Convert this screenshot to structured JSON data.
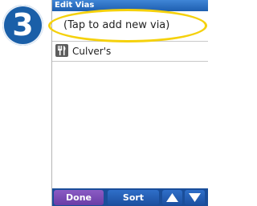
{
  "step_badge": "3",
  "window": {
    "title": "Edit Vias"
  },
  "list": {
    "add_row_label": "(Tap to add new via)",
    "items": [
      {
        "label": "Culver's",
        "icon": "restaurant-icon"
      }
    ]
  },
  "toolbar": {
    "done_label": "Done",
    "sort_label": "Sort",
    "up_icon": "arrow-up-icon",
    "down_icon": "arrow-down-icon"
  },
  "colors": {
    "title_bar": "#1e5fb0",
    "badge": "#1a5fa8",
    "highlight": "#f5d10c",
    "done_button": "#6a3da6",
    "toolbar": "#1a4e9a"
  }
}
